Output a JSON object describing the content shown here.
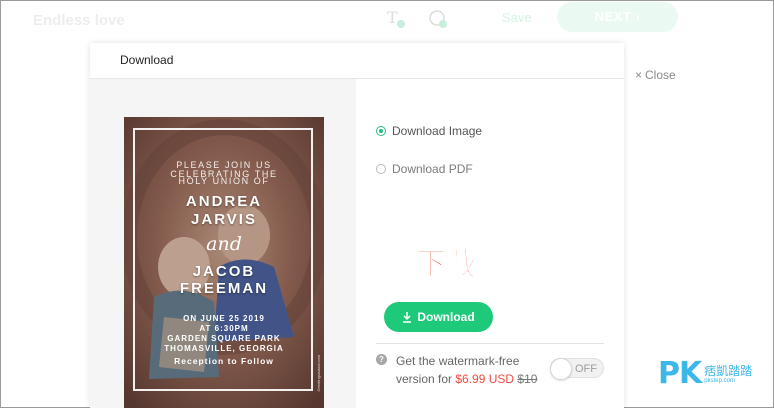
{
  "editor": {
    "title": "Endless love",
    "save_label": "Save",
    "next_label": "NEXT ›"
  },
  "close": {
    "icon": "×",
    "label": "Close"
  },
  "modal": {
    "title": "Download",
    "preview": {
      "line1": "PLEASE JOIN US",
      "line2": "CELEBRATING THE",
      "line3": "HOLY UNION OF",
      "name1": "ANDREA",
      "name2": "JARVIS",
      "and": "and",
      "name3": "JACOB",
      "name4": "FREEMAN",
      "date": "ON JUNE 25 2019",
      "time": "AT 6:30PM",
      "place": "GARDEN SQUARE PARK",
      "city": "THOMASVILLE, GEORGIA",
      "reception": "Reception to Follow",
      "side_mark": "Greetingsisland.com"
    },
    "options": [
      {
        "label": "Download Image",
        "selected": true
      },
      {
        "label": "Download PDF",
        "selected": false
      }
    ],
    "overlay_label": "下載",
    "download_button": "Download",
    "watermark_offer": {
      "text1": "Get the watermark-free",
      "text2": "version for",
      "price": "$6.99 USD",
      "old_price": "$10",
      "toggle_label": "OFF"
    }
  },
  "site_watermark": {
    "logo": "PK",
    "name": "痞凱踏踏",
    "url": "pkstep.com"
  },
  "colors": {
    "accent": "#1ec97a",
    "price": "#ef4a43",
    "overlay": "#e8331c",
    "watermark": "#3cb8e8"
  }
}
